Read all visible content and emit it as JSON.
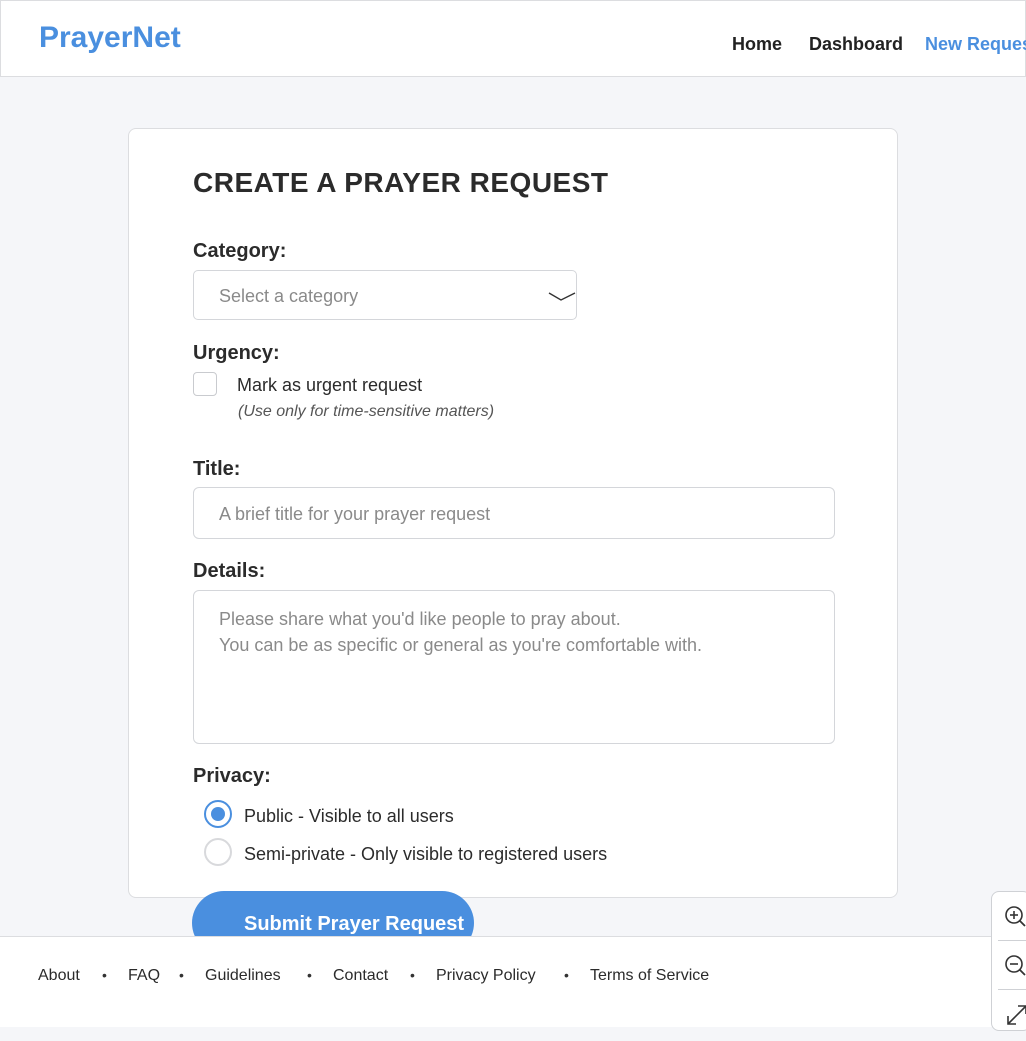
{
  "header": {
    "logo": "PrayerNet",
    "nav": [
      {
        "label": "Home"
      },
      {
        "label": "Dashboard"
      },
      {
        "label": "New Request"
      }
    ]
  },
  "form": {
    "title": "CREATE A PRAYER REQUEST",
    "category": {
      "label": "Category:",
      "placeholder": "Select a category"
    },
    "urgency": {
      "label": "Urgency:",
      "checkbox_label": "Mark as urgent request",
      "note": "(Use only for time-sensitive matters)",
      "checked": false
    },
    "title_field": {
      "label": "Title:",
      "placeholder": "A brief title for your prayer request"
    },
    "details": {
      "label": "Details:",
      "placeholder_line1": "Please share what you'd like people to pray about.",
      "placeholder_line2": "You can be as specific or general as you're comfortable with."
    },
    "privacy": {
      "label": "Privacy:",
      "options": [
        {
          "label": "Public - Visible to all users",
          "selected": true
        },
        {
          "label": "Semi-private - Only visible to registered users",
          "selected": false
        }
      ]
    },
    "submit_label": "Submit Prayer Request"
  },
  "footer": {
    "links": [
      "About",
      "FAQ",
      "Guidelines",
      "Contact",
      "Privacy Policy",
      "Terms of Service"
    ],
    "separator": "•"
  },
  "zoom_controls": [
    "zoom-in-icon",
    "zoom-out-icon",
    "fullscreen-icon"
  ],
  "colors": {
    "accent": "#4a8fdf",
    "background": "#f5f6f9"
  }
}
